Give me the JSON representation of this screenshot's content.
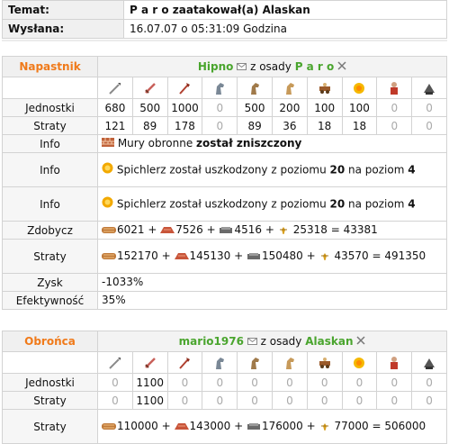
{
  "header": {
    "subject_label": "Temat:",
    "subject_value": "P a r o zaatakował(a) Alaskan",
    "sent_label": "Wysłana:",
    "sent_value": "16.07.07 o 05:31:09 Godzina"
  },
  "unit_icons": [
    "spear-icon",
    "sword-icon",
    "axe-icon",
    "scout-horse-icon",
    "light-cavalry-icon",
    "heavy-cavalry-icon",
    "ram-icon",
    "catapult-icon",
    "knight-icon",
    "snob-icon"
  ],
  "attacker": {
    "side_label": "Napastnik",
    "player": "Hipno",
    "from_text": "z osady",
    "village": "P a r o",
    "rows": [
      {
        "label": "Jednostki",
        "values": [
          "680",
          "500",
          "1000",
          "0",
          "500",
          "200",
          "100",
          "100",
          "0",
          "0"
        ]
      },
      {
        "label": "Straty",
        "values": [
          "121",
          "89",
          "178",
          "0",
          "89",
          "36",
          "18",
          "18",
          "0",
          "0"
        ]
      }
    ],
    "info": [
      {
        "label": "Info",
        "pre": "Mury obronne ",
        "bold": "został zniszczony",
        "post": ""
      },
      {
        "label": "Info",
        "pre": "Spichlerz został uszkodzony z poziomu ",
        "bold": "20",
        "mid": " na poziom ",
        "bold2": "4"
      },
      {
        "label": "Info",
        "pre": "Spichlerz został uszkodzony z poziomu ",
        "bold": "20",
        "mid": " na poziom ",
        "bold2": "4"
      }
    ],
    "loot": {
      "label": "Zdobycz",
      "wood": "6021",
      "clay": "7526",
      "iron": "4516",
      "grain": "25318",
      "total": "43381"
    },
    "loss": {
      "label": "Straty",
      "wood": "152170",
      "clay": "145130",
      "iron": "150480",
      "grain": "43570",
      "total": "491350"
    },
    "gain": {
      "label": "Zysk",
      "value": "-1033%"
    },
    "eff": {
      "label": "Efektywność",
      "value": "35%"
    }
  },
  "defender": {
    "side_label": "Obrońca",
    "player": "mario1976",
    "from_text": "z osady",
    "village": "Alaskan",
    "rows": [
      {
        "label": "Jednostki",
        "values": [
          "0",
          "1100",
          "0",
          "0",
          "0",
          "0",
          "0",
          "0",
          "0",
          "0"
        ]
      },
      {
        "label": "Straty",
        "values": [
          "0",
          "1100",
          "0",
          "0",
          "0",
          "0",
          "0",
          "0",
          "0",
          "0"
        ]
      }
    ],
    "loss": {
      "label": "Straty",
      "wood": "110000",
      "clay": "143000",
      "iron": "176000",
      "grain": "77000",
      "total": "506000"
    }
  },
  "colors": {
    "orange": "#f07a1a",
    "green": "#4aa52e",
    "zero": "#aaaaaa",
    "border": "#d3d3d3"
  }
}
